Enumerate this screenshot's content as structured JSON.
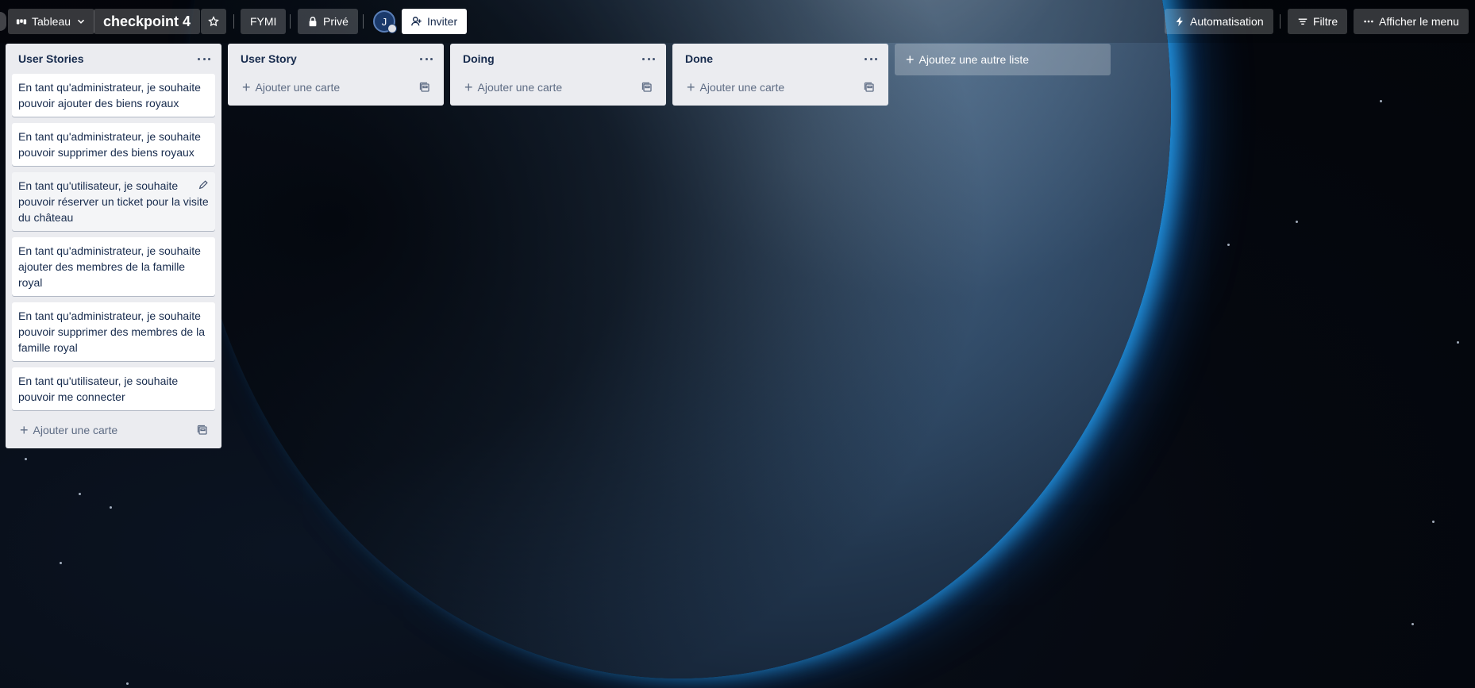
{
  "header": {
    "view_switcher_label": "Tableau",
    "board_title": "checkpoint 4",
    "workspace_label": "FYMI",
    "visibility_label": "Privé",
    "avatar_initial": "J",
    "invite_label": "Inviter",
    "automation_label": "Automatisation",
    "filter_label": "Filtre",
    "menu_label": "Afficher le menu"
  },
  "lists": [
    {
      "title": "User Stories",
      "cards": [
        "En tant qu'administrateur, je souhaite pouvoir ajouter des biens royaux",
        "En tant qu'administrateur, je souhaite pouvoir supprimer des biens royaux",
        "En tant qu'utilisateur, je souhaite pouvoir réserver un ticket pour la visite du château",
        "En tant qu'administrateur, je souhaite ajouter des membres de la famille royal",
        "En tant qu'administrateur, je souhaite pouvoir supprimer des membres de la famille royal",
        "En tant qu'utilisateur, je souhaite pouvoir me connecter"
      ],
      "add_card_label": "Ajouter une carte"
    },
    {
      "title": "User Story",
      "cards": [],
      "add_card_label": "Ajouter une carte"
    },
    {
      "title": "Doing",
      "cards": [],
      "add_card_label": "Ajouter une carte"
    },
    {
      "title": "Done",
      "cards": [],
      "add_card_label": "Ajouter une carte"
    }
  ],
  "add_list_label": "Ajoutez une autre liste",
  "colors": {
    "list_bg": "#ebecf0",
    "card_bg": "#ffffff",
    "text": "#172b4d",
    "muted": "#5e6c84",
    "earth_glow": "#28aaff"
  }
}
